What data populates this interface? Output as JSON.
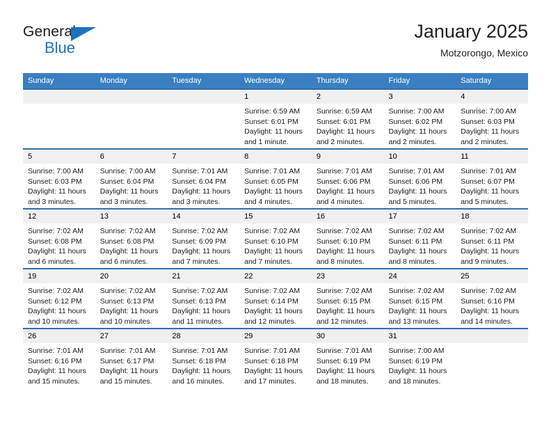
{
  "brand": {
    "name_top": "General",
    "name_bottom": "Blue",
    "accent_color": "#1f72bd"
  },
  "header": {
    "title": "January 2025",
    "subtitle": "Motzorongo, Mexico"
  },
  "calendar": {
    "header_bg": "#3a7fc1",
    "row_divider_color": "#2f6fad",
    "daynum_bg": "#f0f0f0",
    "weekdays": [
      "Sunday",
      "Monday",
      "Tuesday",
      "Wednesday",
      "Thursday",
      "Friday",
      "Saturday"
    ],
    "weeks": [
      [
        {
          "day": "",
          "lines": []
        },
        {
          "day": "",
          "lines": []
        },
        {
          "day": "",
          "lines": []
        },
        {
          "day": "1",
          "lines": [
            "Sunrise: 6:59 AM",
            "Sunset: 6:01 PM",
            "Daylight: 11 hours",
            "and 1 minute."
          ]
        },
        {
          "day": "2",
          "lines": [
            "Sunrise: 6:59 AM",
            "Sunset: 6:01 PM",
            "Daylight: 11 hours",
            "and 2 minutes."
          ]
        },
        {
          "day": "3",
          "lines": [
            "Sunrise: 7:00 AM",
            "Sunset: 6:02 PM",
            "Daylight: 11 hours",
            "and 2 minutes."
          ]
        },
        {
          "day": "4",
          "lines": [
            "Sunrise: 7:00 AM",
            "Sunset: 6:03 PM",
            "Daylight: 11 hours",
            "and 2 minutes."
          ]
        }
      ],
      [
        {
          "day": "5",
          "lines": [
            "Sunrise: 7:00 AM",
            "Sunset: 6:03 PM",
            "Daylight: 11 hours",
            "and 3 minutes."
          ]
        },
        {
          "day": "6",
          "lines": [
            "Sunrise: 7:00 AM",
            "Sunset: 6:04 PM",
            "Daylight: 11 hours",
            "and 3 minutes."
          ]
        },
        {
          "day": "7",
          "lines": [
            "Sunrise: 7:01 AM",
            "Sunset: 6:04 PM",
            "Daylight: 11 hours",
            "and 3 minutes."
          ]
        },
        {
          "day": "8",
          "lines": [
            "Sunrise: 7:01 AM",
            "Sunset: 6:05 PM",
            "Daylight: 11 hours",
            "and 4 minutes."
          ]
        },
        {
          "day": "9",
          "lines": [
            "Sunrise: 7:01 AM",
            "Sunset: 6:06 PM",
            "Daylight: 11 hours",
            "and 4 minutes."
          ]
        },
        {
          "day": "10",
          "lines": [
            "Sunrise: 7:01 AM",
            "Sunset: 6:06 PM",
            "Daylight: 11 hours",
            "and 5 minutes."
          ]
        },
        {
          "day": "11",
          "lines": [
            "Sunrise: 7:01 AM",
            "Sunset: 6:07 PM",
            "Daylight: 11 hours",
            "and 5 minutes."
          ]
        }
      ],
      [
        {
          "day": "12",
          "lines": [
            "Sunrise: 7:02 AM",
            "Sunset: 6:08 PM",
            "Daylight: 11 hours",
            "and 6 minutes."
          ]
        },
        {
          "day": "13",
          "lines": [
            "Sunrise: 7:02 AM",
            "Sunset: 6:08 PM",
            "Daylight: 11 hours",
            "and 6 minutes."
          ]
        },
        {
          "day": "14",
          "lines": [
            "Sunrise: 7:02 AM",
            "Sunset: 6:09 PM",
            "Daylight: 11 hours",
            "and 7 minutes."
          ]
        },
        {
          "day": "15",
          "lines": [
            "Sunrise: 7:02 AM",
            "Sunset: 6:10 PM",
            "Daylight: 11 hours",
            "and 7 minutes."
          ]
        },
        {
          "day": "16",
          "lines": [
            "Sunrise: 7:02 AM",
            "Sunset: 6:10 PM",
            "Daylight: 11 hours",
            "and 8 minutes."
          ]
        },
        {
          "day": "17",
          "lines": [
            "Sunrise: 7:02 AM",
            "Sunset: 6:11 PM",
            "Daylight: 11 hours",
            "and 8 minutes."
          ]
        },
        {
          "day": "18",
          "lines": [
            "Sunrise: 7:02 AM",
            "Sunset: 6:11 PM",
            "Daylight: 11 hours",
            "and 9 minutes."
          ]
        }
      ],
      [
        {
          "day": "19",
          "lines": [
            "Sunrise: 7:02 AM",
            "Sunset: 6:12 PM",
            "Daylight: 11 hours",
            "and 10 minutes."
          ]
        },
        {
          "day": "20",
          "lines": [
            "Sunrise: 7:02 AM",
            "Sunset: 6:13 PM",
            "Daylight: 11 hours",
            "and 10 minutes."
          ]
        },
        {
          "day": "21",
          "lines": [
            "Sunrise: 7:02 AM",
            "Sunset: 6:13 PM",
            "Daylight: 11 hours",
            "and 11 minutes."
          ]
        },
        {
          "day": "22",
          "lines": [
            "Sunrise: 7:02 AM",
            "Sunset: 6:14 PM",
            "Daylight: 11 hours",
            "and 12 minutes."
          ]
        },
        {
          "day": "23",
          "lines": [
            "Sunrise: 7:02 AM",
            "Sunset: 6:15 PM",
            "Daylight: 11 hours",
            "and 12 minutes."
          ]
        },
        {
          "day": "24",
          "lines": [
            "Sunrise: 7:02 AM",
            "Sunset: 6:15 PM",
            "Daylight: 11 hours",
            "and 13 minutes."
          ]
        },
        {
          "day": "25",
          "lines": [
            "Sunrise: 7:02 AM",
            "Sunset: 6:16 PM",
            "Daylight: 11 hours",
            "and 14 minutes."
          ]
        }
      ],
      [
        {
          "day": "26",
          "lines": [
            "Sunrise: 7:01 AM",
            "Sunset: 6:16 PM",
            "Daylight: 11 hours",
            "and 15 minutes."
          ]
        },
        {
          "day": "27",
          "lines": [
            "Sunrise: 7:01 AM",
            "Sunset: 6:17 PM",
            "Daylight: 11 hours",
            "and 15 minutes."
          ]
        },
        {
          "day": "28",
          "lines": [
            "Sunrise: 7:01 AM",
            "Sunset: 6:18 PM",
            "Daylight: 11 hours",
            "and 16 minutes."
          ]
        },
        {
          "day": "29",
          "lines": [
            "Sunrise: 7:01 AM",
            "Sunset: 6:18 PM",
            "Daylight: 11 hours",
            "and 17 minutes."
          ]
        },
        {
          "day": "30",
          "lines": [
            "Sunrise: 7:01 AM",
            "Sunset: 6:19 PM",
            "Daylight: 11 hours",
            "and 18 minutes."
          ]
        },
        {
          "day": "31",
          "lines": [
            "Sunrise: 7:00 AM",
            "Sunset: 6:19 PM",
            "Daylight: 11 hours",
            "and 18 minutes."
          ]
        },
        {
          "day": "",
          "lines": []
        }
      ]
    ]
  }
}
